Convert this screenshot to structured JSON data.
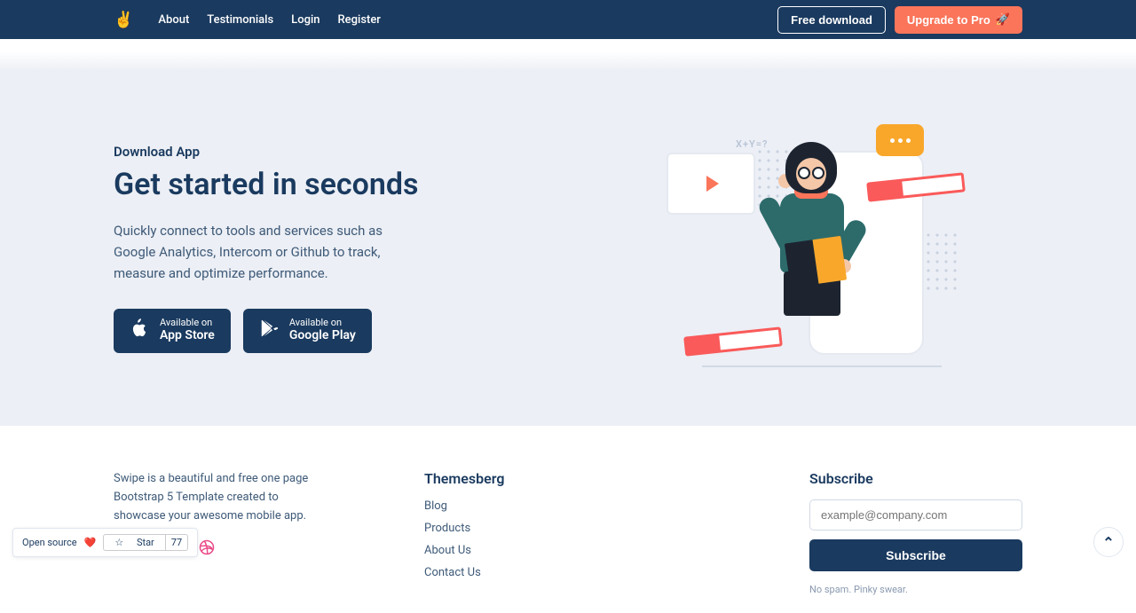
{
  "nav": {
    "links": [
      "About",
      "Testimonials",
      "Login",
      "Register"
    ],
    "free_download": "Free download",
    "upgrade": "Upgrade to Pro"
  },
  "download": {
    "eyebrow": "Download App",
    "title": "Get started in seconds",
    "desc": "Quickly connect to tools and services such as Google Analytics, Intercom or Github to track, measure and optimize performance.",
    "store_small": "Available on",
    "appstore": "App Store",
    "googleplay": "Google Play",
    "formula": "X+Y=?"
  },
  "footer": {
    "about": "Swipe is a beautiful and free one page Bootstrap 5 Template created to showcase your awesome mobile app.",
    "col_title": "Themesberg",
    "links": [
      "Blog",
      "Products",
      "About Us",
      "Contact Us"
    ],
    "sub_title": "Subscribe",
    "placeholder": "example@company.com",
    "sub_btn": "Subscribe",
    "spam": "No spam. Pinky swear."
  },
  "badge": {
    "label": "Open source",
    "star": "Star",
    "count": "77"
  }
}
